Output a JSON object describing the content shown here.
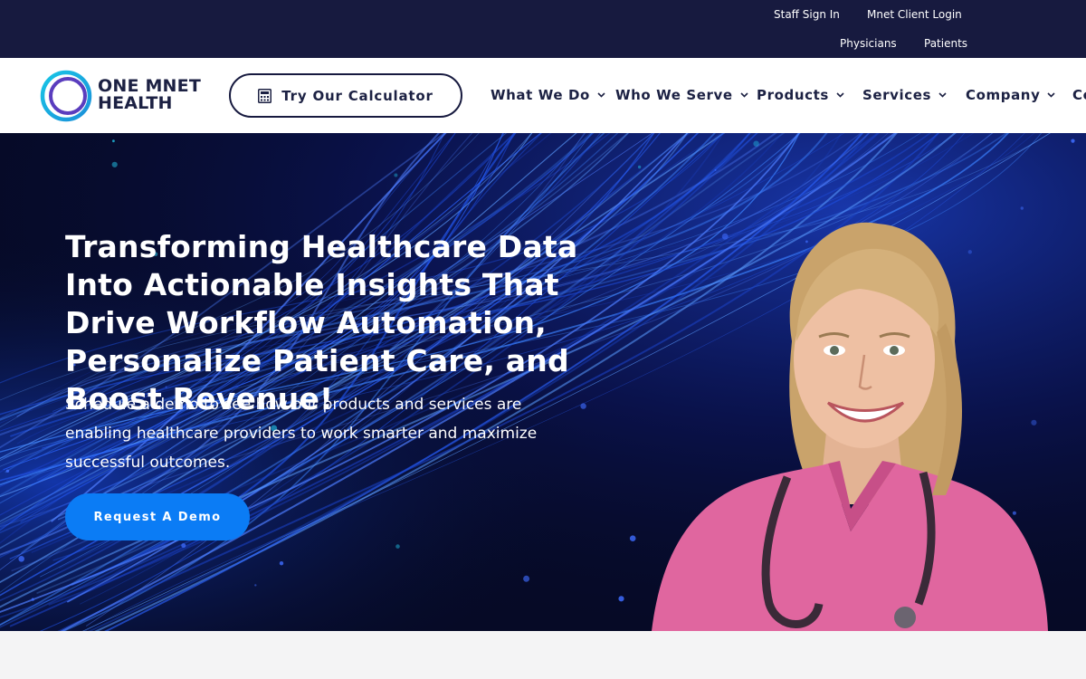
{
  "topbar": {
    "links_row1": [
      "Staff Sign In",
      "Mnet Client Login"
    ],
    "links_row2": [
      "Physicians",
      "Patients"
    ]
  },
  "brand": {
    "line1": "ONE MNET",
    "line2": "HEALTH"
  },
  "nav": {
    "calculator_label": "Try Our Calculator",
    "items": [
      "What We Do",
      "Who We Serve",
      "Products",
      "Services",
      "Company",
      "Co"
    ]
  },
  "hero": {
    "title": "Transforming Healthcare Data Into Actionable Insights That Drive Workflow Automation, Personalize Patient Care, and Boost Revenue!",
    "subtitle": "Schedule a demo to see how our products and services are enabling healthcare providers to work smarter and maximize successful outcomes.",
    "cta_label": "Request A Demo"
  },
  "colors": {
    "topbar_bg": "#171a3f",
    "nav_text": "#1c2143",
    "cta_blue": "#0b7cf5",
    "hero_bg": "#060a26",
    "scrubs_pink": "#e0669f"
  },
  "icons": {
    "calculator": "calculator-icon",
    "chevron": "chevron-down-icon"
  }
}
